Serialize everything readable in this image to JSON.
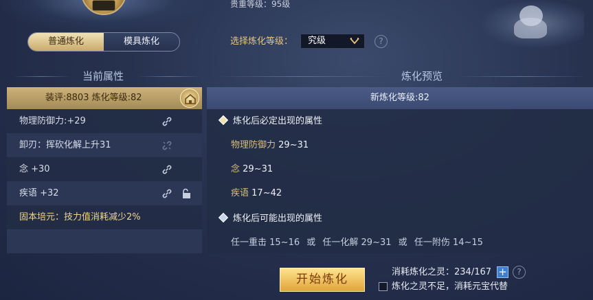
{
  "header": {
    "top_level_text": "贵重等级：95级"
  },
  "tabs": [
    {
      "label": "普通炼化",
      "active": true
    },
    {
      "label": "模具炼化",
      "active": false
    }
  ],
  "level_select": {
    "label": "选择炼化等级：",
    "value": "究级",
    "help": "?"
  },
  "current_attributes": {
    "title": "当前属性",
    "header": "装评:8803   炼化等级:82",
    "rows": [
      {
        "text": "物理防御力:+29",
        "link_icon": "link-icon"
      },
      {
        "text": "卸刃：挥砍化解上升31",
        "link_icon": "link-broken-icon"
      },
      {
        "text": "念 +30",
        "link_icon": "link-icon"
      },
      {
        "text": "疾语 +32",
        "link_icon": "link-icon",
        "lock_icon": "unlock-icon"
      },
      {
        "text": "固本培元：技力值消耗减少2%"
      }
    ]
  },
  "preview": {
    "title": "炼化预览",
    "header": "新炼化等级:82",
    "guaranteed_title": "炼化后必定出现的属性",
    "guaranteed": [
      {
        "name": "物理防御力",
        "range": "29~31"
      },
      {
        "name": "念",
        "range": "29~31"
      },
      {
        "name": "疾语",
        "range": "17~42"
      }
    ],
    "possible_title": "炼化后可能出现的属性",
    "possible": [
      {
        "text": "任一重击 15~16"
      },
      {
        "text": "任一化解 29~31"
      },
      {
        "text": "任一附伤 14~15"
      }
    ],
    "or_word": "或"
  },
  "footer": {
    "start_button": "开始炼化",
    "consume_text": "消耗炼化之灵：234/167",
    "substitute_text": "炼化之灵不足，消耗元宝代替",
    "help": "?"
  },
  "colors": {
    "accent_gold": "#e7c47b",
    "tab_active": "#c9ab6c",
    "start_button": "#e0a53a"
  }
}
